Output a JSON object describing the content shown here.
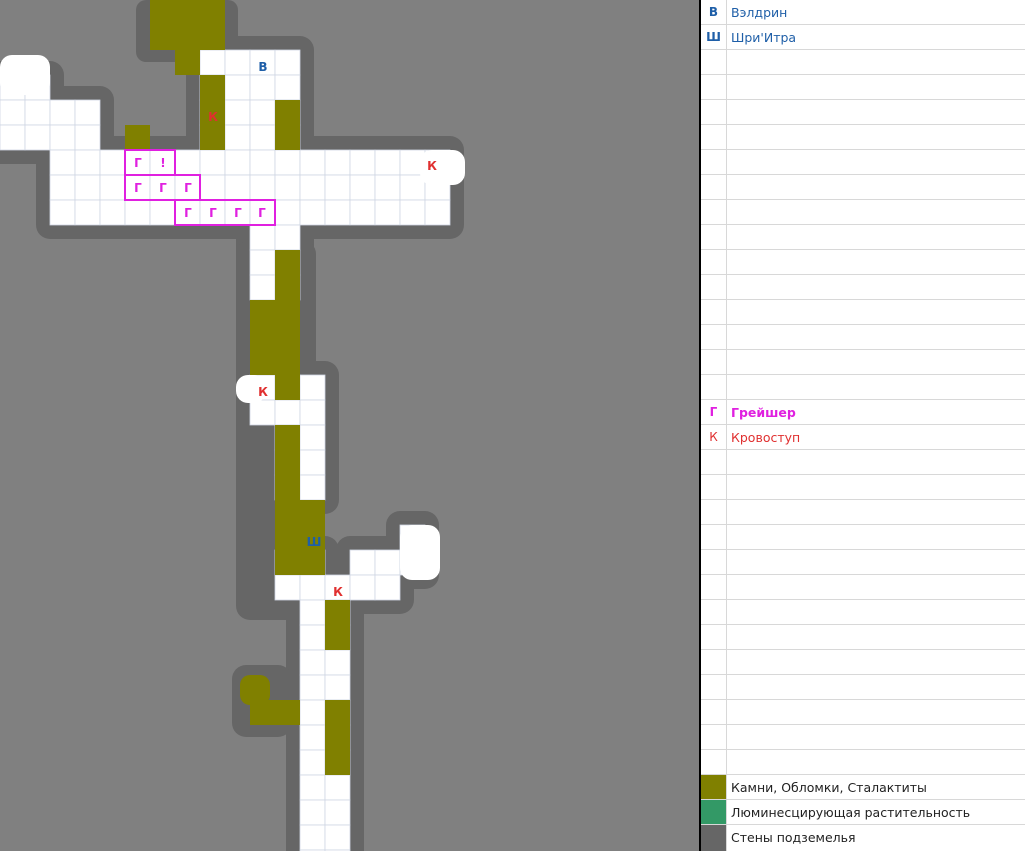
{
  "colors": {
    "background": "#808080",
    "wall": "#666666",
    "floor": "#ffffff",
    "grid": "#cfd6e3",
    "rocks": "#808000",
    "fungus": "#339966",
    "ally": "#1f5fa8",
    "graysher": "#e020e0",
    "krovostup": "#e03030"
  },
  "legend": {
    "veldrin_symbol": "В",
    "veldrin_name": "Вэлдрин",
    "shri_symbol": "Ш",
    "shri_name": "Шри'Итра",
    "graysher_symbol": "Г",
    "graysher_name": "Грейшер",
    "krovostup_symbol": "К",
    "krovostup_name": "Кровоступ",
    "rocks_label": "Камни, Обломки, Сталактиты",
    "fungus_label": "Люминесцирующая растительность",
    "walls_label": "Стены подземелья"
  },
  "map": {
    "graysher_marks": [
      "Г",
      "Г",
      "Г",
      "Г",
      "Г",
      "Г",
      "Г",
      "Г"
    ],
    "alert_mark": "!",
    "veldrin_mark": "В",
    "shri_mark": "Ш",
    "krovostup_marks": [
      "К",
      "К",
      "К",
      "К"
    ]
  }
}
